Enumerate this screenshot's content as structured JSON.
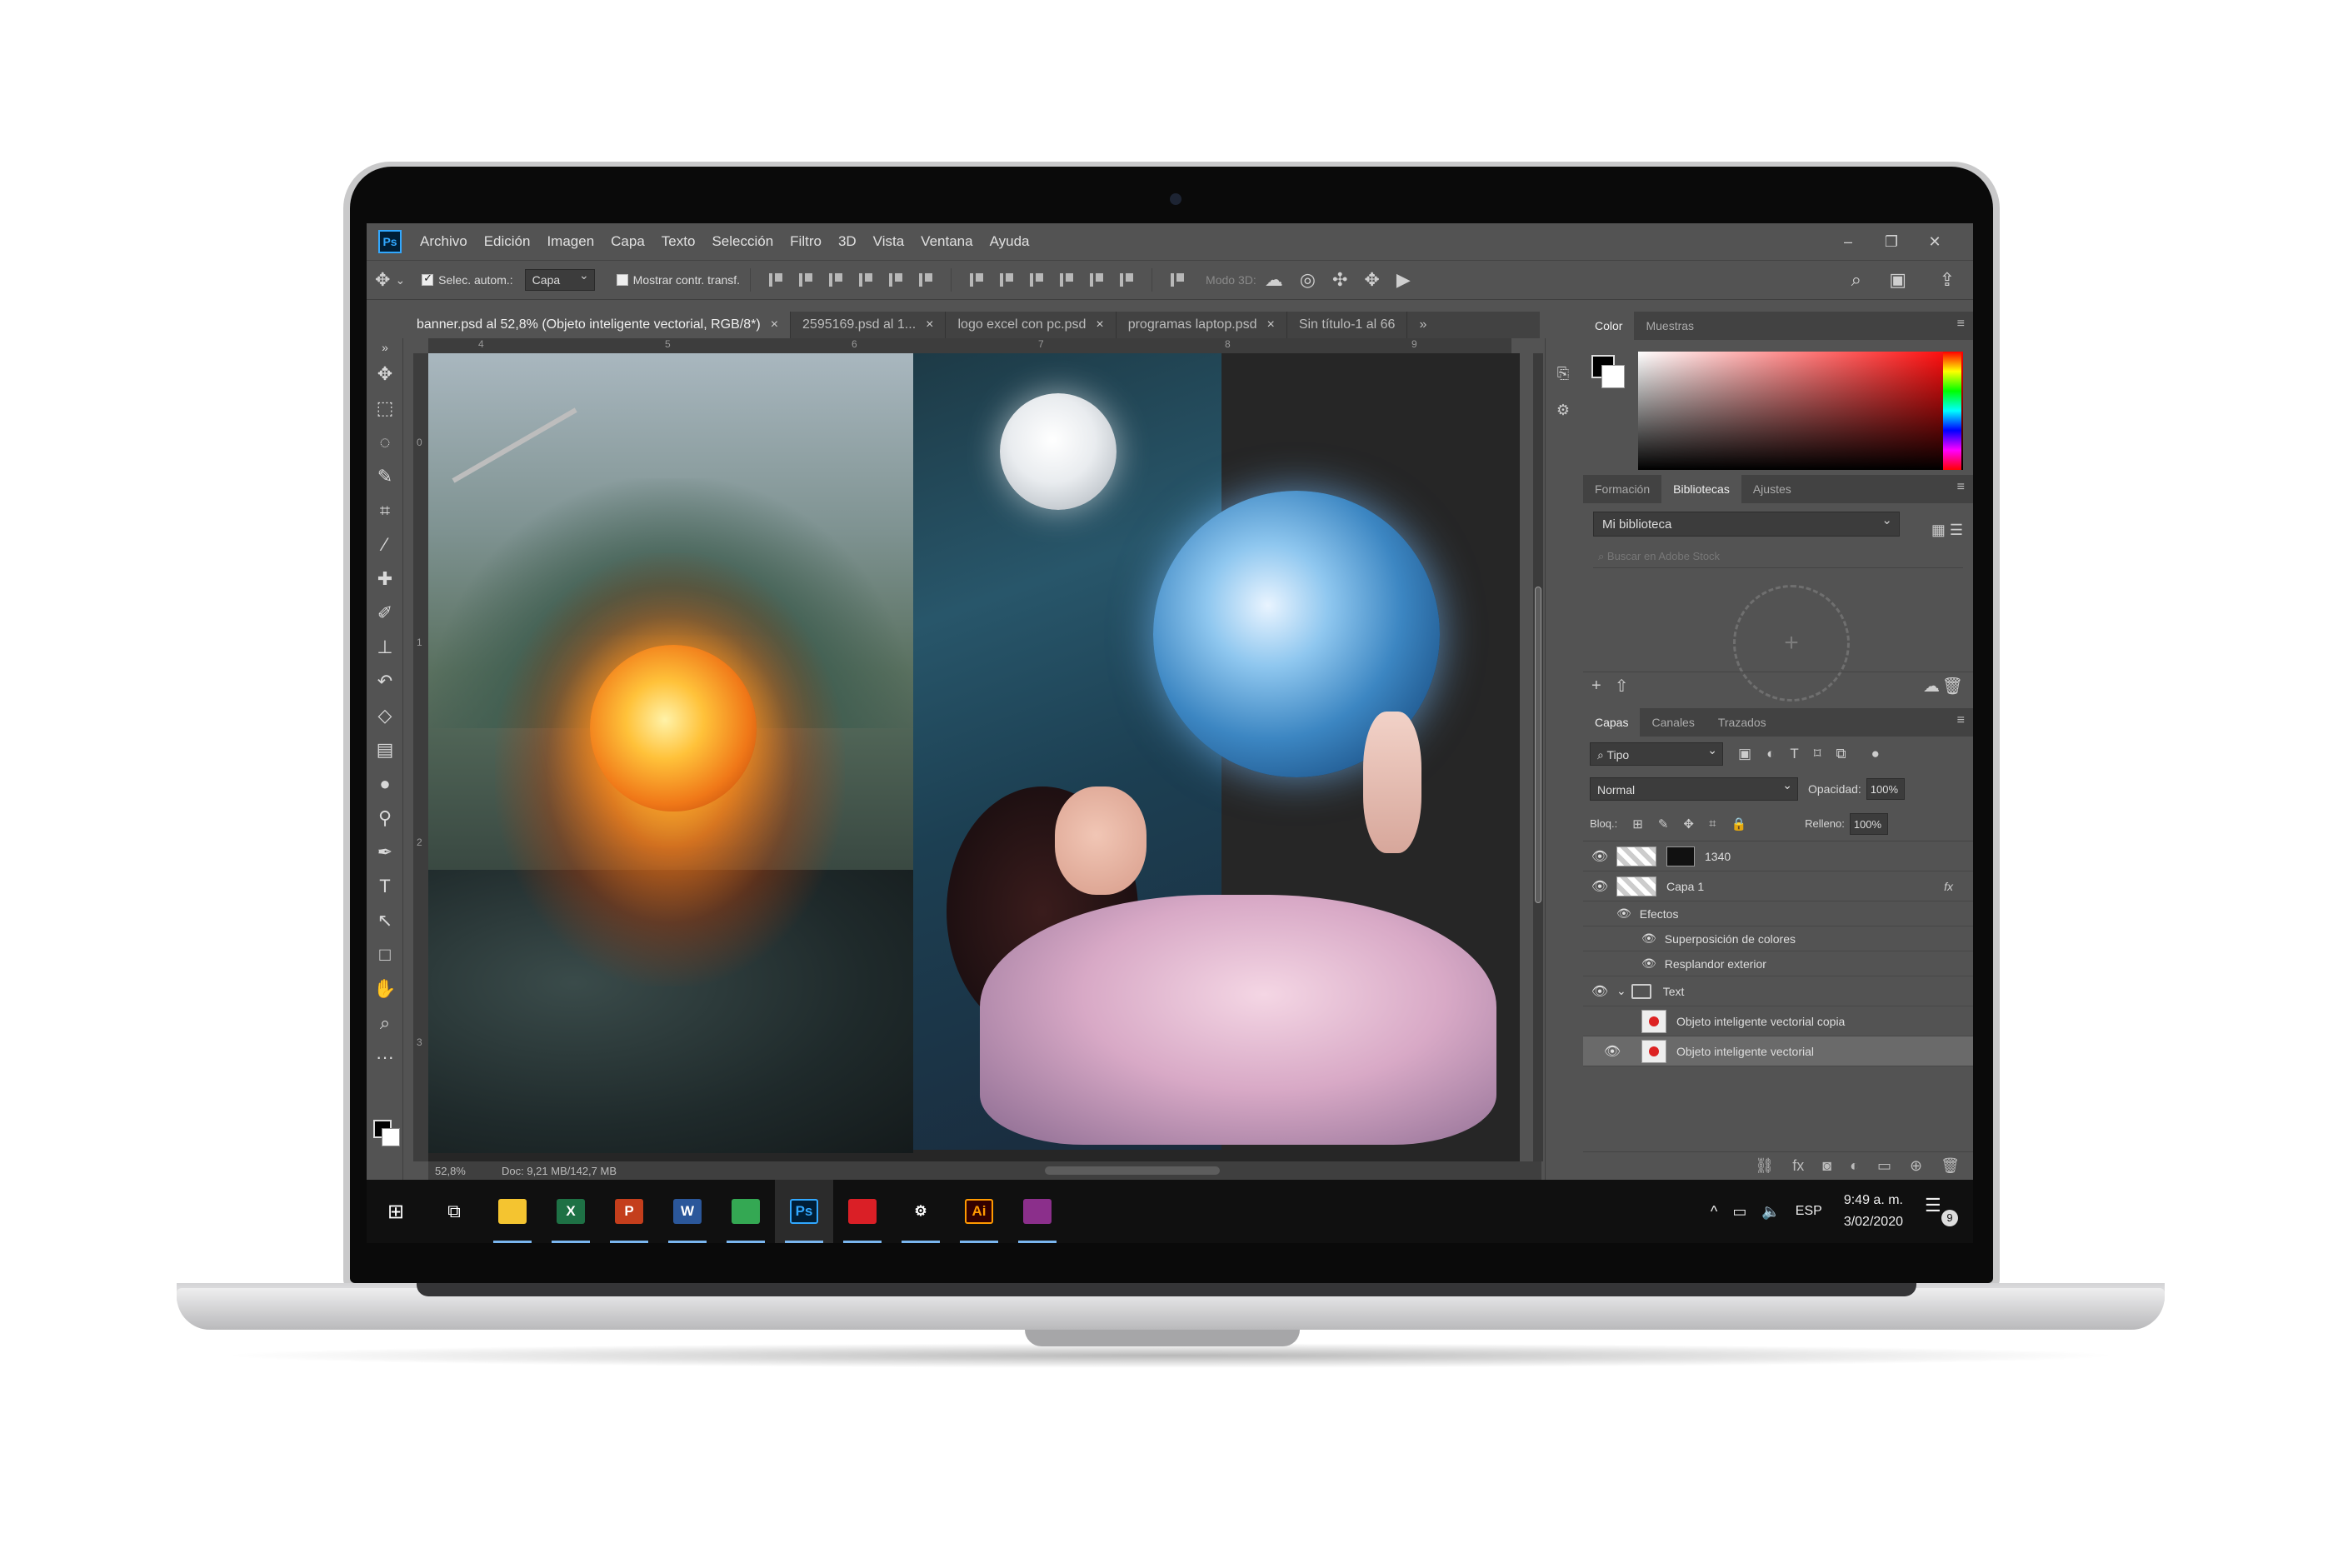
{
  "app": {
    "logo": "Ps"
  },
  "menu": [
    "Archivo",
    "Edición",
    "Imagen",
    "Capa",
    "Texto",
    "Selección",
    "Filtro",
    "3D",
    "Vista",
    "Ventana",
    "Ayuda"
  ],
  "options": {
    "auto_select_label": "Selec. autom.:",
    "auto_select_value": "Capa",
    "show_transform_label": "Mostrar contr. transf.",
    "mode_3d_label": "Modo 3D:"
  },
  "tabs": [
    {
      "label": "banner.psd al 52,8% (Objeto inteligente vectorial, RGB/8*)",
      "active": true
    },
    {
      "label": "2595169.psd al 1...",
      "active": false
    },
    {
      "label": "logo excel con pc.psd",
      "active": false
    },
    {
      "label": "programas laptop.psd",
      "active": false
    },
    {
      "label": "Sin título-1 al 66",
      "active": false
    }
  ],
  "ruler": {
    "h": [
      "4",
      "5",
      "6",
      "7",
      "8",
      "9"
    ],
    "v": [
      "0",
      "1",
      "2",
      "3"
    ]
  },
  "status": {
    "zoom": "52,8%",
    "doc": "Doc: 9,21 MB/142,7 MB"
  },
  "panels": {
    "color_tabs": [
      "Color",
      "Muestras"
    ],
    "library_tabs": [
      "Formación",
      "Bibliotecas",
      "Ajustes"
    ],
    "library_name": "Mi biblioteca",
    "library_search_placeholder": "Buscar en Adobe Stock",
    "layers_tabs": [
      "Capas",
      "Canales",
      "Trazados"
    ],
    "kind_filter": "Tipo",
    "blend_mode": "Normal",
    "opacity_label": "Opacidad:",
    "opacity_value": "100%",
    "lock_label": "Bloq.:",
    "fill_label": "Relleno:",
    "fill_value": "100%"
  },
  "layers": [
    {
      "name": "1340",
      "type": "mask"
    },
    {
      "name": "Capa 1",
      "type": "layer",
      "fx": "fx"
    },
    {
      "name": "Efectos",
      "type": "effects"
    },
    {
      "name": "Superposición de colores",
      "type": "effect"
    },
    {
      "name": "Resplandor exterior",
      "type": "effect"
    },
    {
      "name": "Text",
      "type": "group"
    },
    {
      "name": "Objeto inteligente vectorial copia",
      "type": "smart"
    },
    {
      "name": "Objeto inteligente vectorial",
      "type": "smart",
      "selected": true
    }
  ],
  "taskbar": {
    "apps": [
      {
        "icon": "file-explorer-icon",
        "glyph": "",
        "color": "#f4c430"
      },
      {
        "icon": "excel-icon",
        "glyph": "X",
        "color": "#1e7145"
      },
      {
        "icon": "powerpoint-icon",
        "glyph": "P",
        "color": "#c43e1c"
      },
      {
        "icon": "word-icon",
        "glyph": "W",
        "color": "#2b579a"
      },
      {
        "icon": "chrome-icon",
        "glyph": "",
        "color": "#34a853"
      },
      {
        "icon": "photoshop-icon",
        "glyph": "Ps",
        "color": "#001e36"
      },
      {
        "icon": "creative-cloud-icon",
        "glyph": "",
        "color": "#da1f26"
      },
      {
        "icon": "settings-icon",
        "glyph": "⚙",
        "color": "#101010"
      },
      {
        "icon": "illustrator-icon",
        "glyph": "Ai",
        "color": "#330000"
      },
      {
        "icon": "winrar-icon",
        "glyph": "",
        "color": "#8b2f8b"
      }
    ],
    "language": "ESP",
    "time": "9:49 a. m.",
    "date": "3/02/2020",
    "notifications": "9"
  }
}
